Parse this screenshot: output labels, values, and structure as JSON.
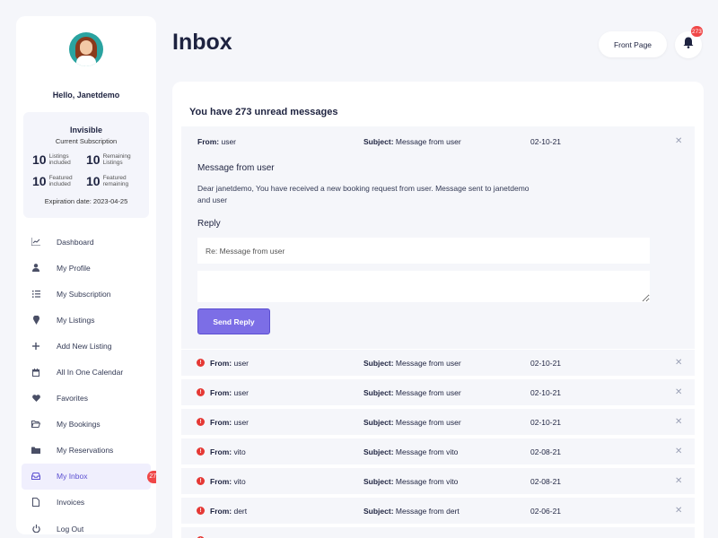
{
  "page": {
    "title": "Inbox"
  },
  "header": {
    "front_page_label": "Front Page",
    "notification_count": "273"
  },
  "sidebar": {
    "greeting": "Hello, Janetdemo",
    "subscription": {
      "plan": "Invisible",
      "label": "Current Subscription",
      "stats": [
        {
          "value": "10",
          "label": "Listings included"
        },
        {
          "value": "10",
          "label": "Remaining Listings"
        },
        {
          "value": "10",
          "label": "Featured included"
        },
        {
          "value": "10",
          "label": "Featured remaining"
        }
      ],
      "expiration": "Expiration date: 2023-04-25"
    },
    "items": [
      {
        "label": "Dashboard",
        "icon": "chart-icon"
      },
      {
        "label": "My Profile",
        "icon": "user-icon"
      },
      {
        "label": "My Subscription",
        "icon": "list-icon"
      },
      {
        "label": "My Listings",
        "icon": "pin-icon"
      },
      {
        "label": "Add New Listing",
        "icon": "plus-icon"
      },
      {
        "label": "All In One Calendar",
        "icon": "calendar-icon"
      },
      {
        "label": "Favorites",
        "icon": "heart-icon"
      },
      {
        "label": "My Bookings",
        "icon": "folder-open-icon"
      },
      {
        "label": "My Reservations",
        "icon": "folder-icon"
      },
      {
        "label": "My Inbox",
        "icon": "inbox-icon",
        "badge": "273"
      },
      {
        "label": "Invoices",
        "icon": "file-icon"
      },
      {
        "label": "Log Out",
        "icon": "power-icon"
      }
    ]
  },
  "inbox": {
    "unread_text": "You have 273 unread messages",
    "from_label": "From:",
    "subject_label": "Subject:",
    "expanded": {
      "from": "user",
      "subject": "Message from user",
      "date": "02-10-21",
      "title": "Message from user",
      "body": "Dear janetdemo, You have received a new booking request from user. Message sent to janetdemo and user",
      "reply_title": "Reply",
      "reply_subject_value": "Re: Message from user",
      "reply_body_value": "",
      "send_label": "Send Reply"
    },
    "messages": [
      {
        "from": "user",
        "subject": "Message from user",
        "date": "02-10-21"
      },
      {
        "from": "user",
        "subject": "Message from user",
        "date": "02-10-21"
      },
      {
        "from": "user",
        "subject": "Message from user",
        "date": "02-10-21"
      },
      {
        "from": "vito",
        "subject": "Message from vito",
        "date": "02-08-21"
      },
      {
        "from": "vito",
        "subject": "Message from vito",
        "date": "02-08-21"
      },
      {
        "from": "dert",
        "subject": "Message from dert",
        "date": "02-06-21"
      }
    ]
  },
  "colors": {
    "accent": "#7c6ee6",
    "badge": "#f04747",
    "background": "#f5f6fa"
  }
}
